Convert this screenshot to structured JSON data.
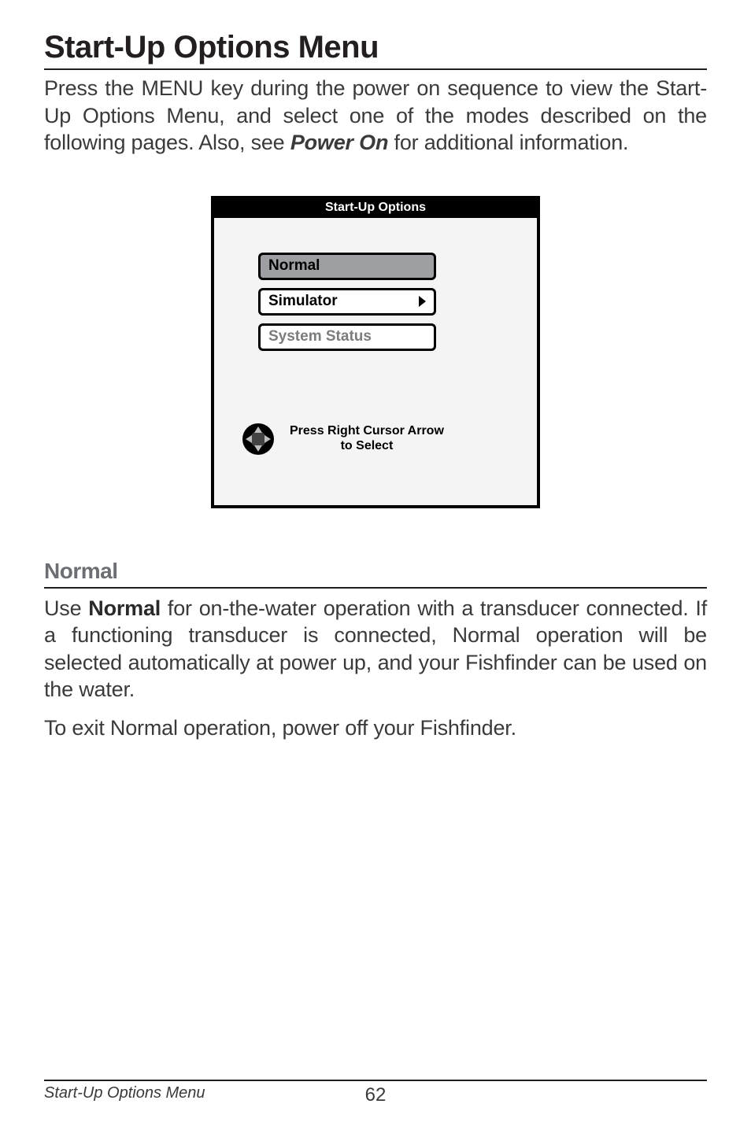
{
  "title": "Start-Up Options Menu",
  "intro_pre": "Press the MENU key during the power on sequence to view the Start-Up Options Menu, and select one of the modes described on the following pages. Also, see ",
  "intro_em": "Power On",
  "intro_post": " for additional information.",
  "screen": {
    "titlebar": "Start-Up Options",
    "options": {
      "normal": "Normal",
      "simulator": "Simulator",
      "system_status": "System Status"
    },
    "hint_line1": "Press Right Cursor Arrow",
    "hint_line2": "to   Select"
  },
  "subhead": "Normal",
  "p2_pre": "Use ",
  "p2_strong": "Normal",
  "p2_post": " for on-the-water operation with a transducer connected. If a functioning transducer is connected, Normal operation will be selected automatically at power up, and your Fishfinder can be used on the water.",
  "p3": "To exit Normal operation, power off your Fishfinder.",
  "footer": {
    "section": "Start-Up Options Menu",
    "page": "62"
  }
}
